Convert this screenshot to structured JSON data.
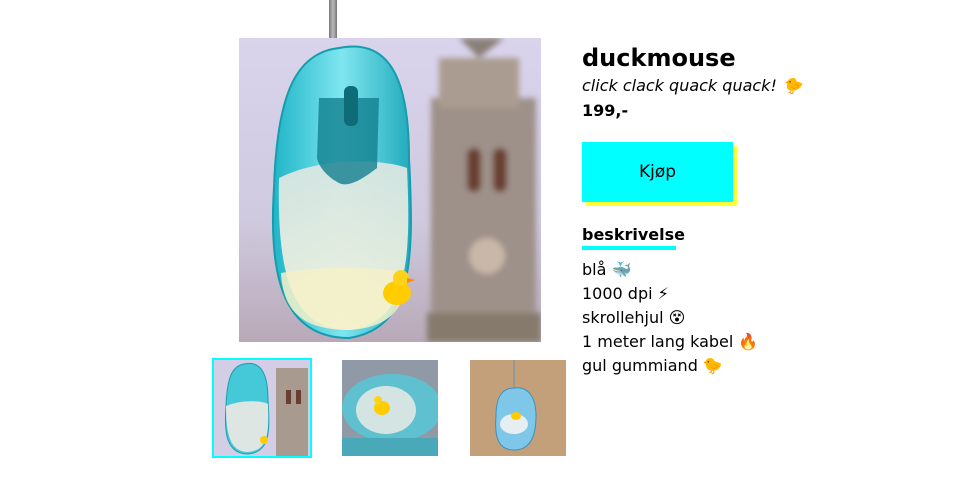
{
  "product": {
    "title": "duckmouse",
    "tagline": "click clack quack quack! 🐤",
    "price": "199,-"
  },
  "buy_button": {
    "label": "Kjøp"
  },
  "description": {
    "heading": "beskrivelse",
    "features": [
      "blå 🐳",
      "1000 dpi ⚡",
      "skrollehjul 😵",
      "1 meter lang kabel 🔥",
      "gul gummiand 🐤"
    ]
  },
  "gallery": {
    "selected_index": 0,
    "thumbnail_count": 3
  },
  "colors": {
    "accent_cyan": "#00ffff",
    "shadow_yellow": "#ffff33",
    "background": "#ffffff"
  }
}
